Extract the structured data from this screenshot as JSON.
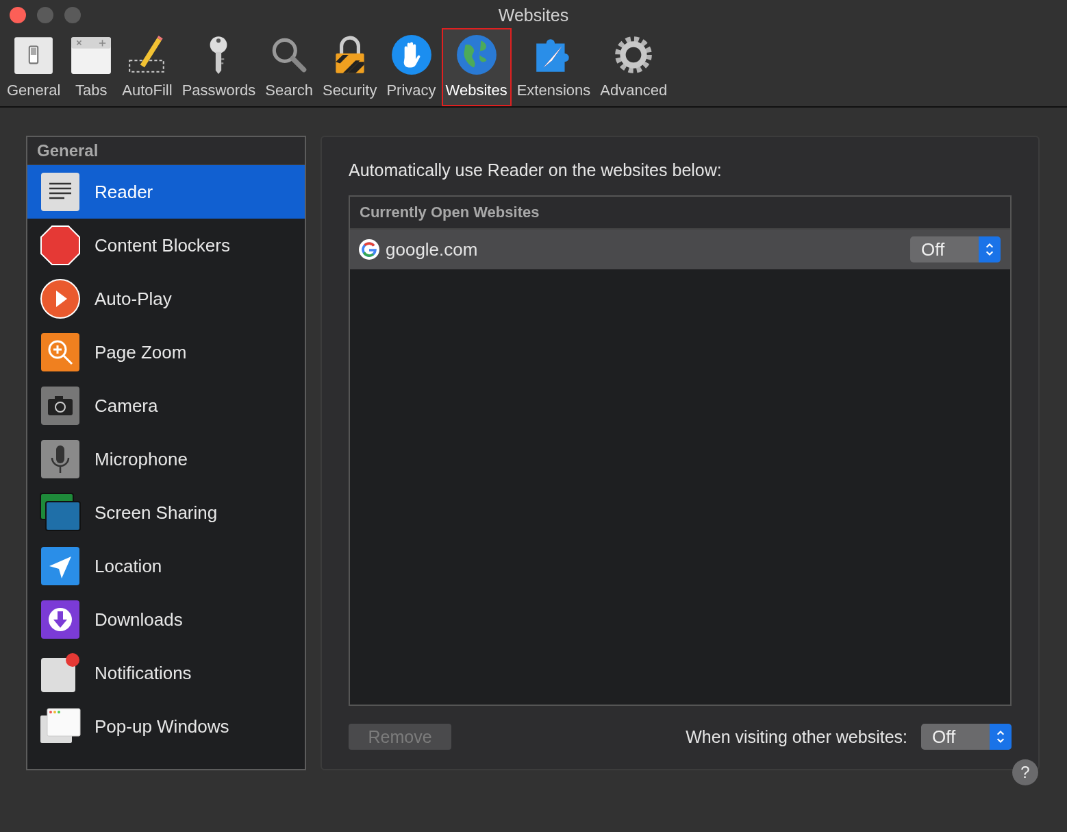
{
  "window": {
    "title": "Websites"
  },
  "toolbar": [
    {
      "label": "General",
      "kind": "general",
      "selected": false
    },
    {
      "label": "Tabs",
      "kind": "tabs",
      "selected": false
    },
    {
      "label": "AutoFill",
      "kind": "autofill",
      "selected": false
    },
    {
      "label": "Passwords",
      "kind": "passwords",
      "selected": false
    },
    {
      "label": "Search",
      "kind": "search",
      "selected": false
    },
    {
      "label": "Security",
      "kind": "security",
      "selected": false
    },
    {
      "label": "Privacy",
      "kind": "privacy",
      "selected": false
    },
    {
      "label": "Websites",
      "kind": "websites",
      "selected": true
    },
    {
      "label": "Extensions",
      "kind": "extensions",
      "selected": false
    },
    {
      "label": "Advanced",
      "kind": "advanced",
      "selected": false
    }
  ],
  "sidebar": {
    "header": "General",
    "items": [
      {
        "label": "Reader",
        "kind": "reader",
        "selected": true
      },
      {
        "label": "Content Blockers",
        "kind": "blockers",
        "selected": false
      },
      {
        "label": "Auto-Play",
        "kind": "autoplay",
        "selected": false
      },
      {
        "label": "Page Zoom",
        "kind": "zoom",
        "selected": false
      },
      {
        "label": "Camera",
        "kind": "camera",
        "selected": false
      },
      {
        "label": "Microphone",
        "kind": "microphone",
        "selected": false
      },
      {
        "label": "Screen Sharing",
        "kind": "screen",
        "selected": false
      },
      {
        "label": "Location",
        "kind": "location",
        "selected": false
      },
      {
        "label": "Downloads",
        "kind": "downloads",
        "selected": false
      },
      {
        "label": "Notifications",
        "kind": "notifications",
        "selected": false
      },
      {
        "label": "Pop-up Windows",
        "kind": "popup",
        "selected": false
      }
    ]
  },
  "panel": {
    "heading": "Automatically use Reader on the websites below:",
    "table": {
      "header": "Currently Open Websites",
      "rows": [
        {
          "site": "google.com",
          "setting": "Off",
          "selected": true
        }
      ]
    },
    "remove_button": {
      "label": "Remove",
      "disabled": true
    },
    "other": {
      "label": "When visiting other websites:",
      "value": "Off"
    }
  },
  "help": "?"
}
